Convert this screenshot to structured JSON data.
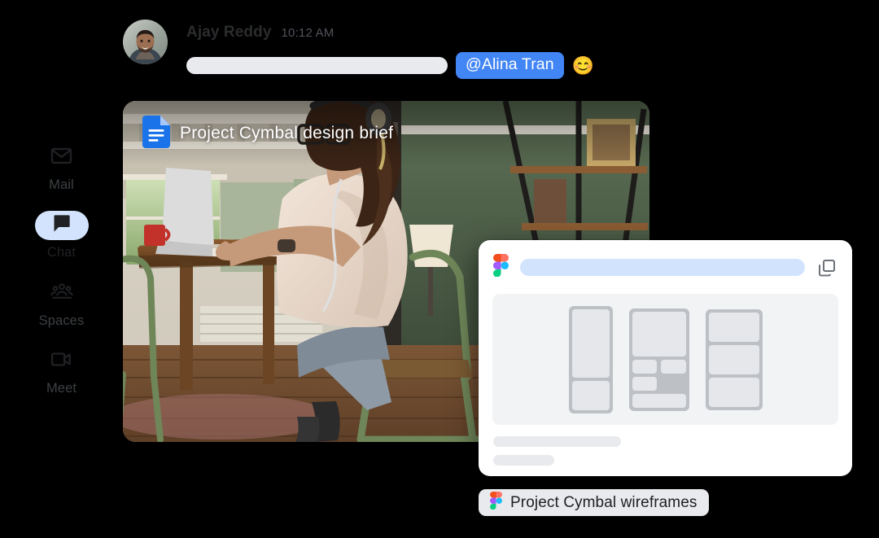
{
  "sidebar": {
    "items": [
      {
        "label": "Mail",
        "icon": "mail-icon",
        "active": false
      },
      {
        "label": "Chat",
        "icon": "chat-icon",
        "active": true
      },
      {
        "label": "Spaces",
        "icon": "spaces-icon",
        "active": false
      },
      {
        "label": "Meet",
        "icon": "meet-icon",
        "active": false
      }
    ]
  },
  "message": {
    "sender": "Ajay Reddy",
    "time": "10:12 AM",
    "avatar_alt": "avatar",
    "mention": "@Alina Tran",
    "emoji": "😊",
    "text_placeholder": ""
  },
  "doc_card": {
    "title": "Project Cymbal design brief",
    "icon": "google-docs-icon",
    "image_alt": "woman with headphones working on a laptop at a wooden table"
  },
  "figma_card": {
    "logo": "figma-icon",
    "url_placeholder": "",
    "copy_icon": "copy-icon",
    "meta_line_1": "",
    "meta_line_2": "",
    "wireframe": {
      "columns": [
        {
          "blocks": [
            {
              "h": 84
            },
            {
              "h": 36
            }
          ]
        },
        {
          "blocks": [
            {
              "h": 55
            },
            {
              "row": [
                {
                  "w": 45
                },
                {
                  "w": 50
                }
              ],
              "h": 18
            },
            {
              "w": 45,
              "h": 18
            },
            {
              "h": 18
            }
          ]
        },
        {
          "blocks": [
            {
              "h": 38
            },
            {
              "h": 38
            },
            {
              "h": 38
            }
          ]
        }
      ]
    }
  },
  "file_chip": {
    "label": "Project Cymbal wireframes",
    "icon": "figma-icon"
  },
  "colors": {
    "accent_blue": "#4285f4",
    "active_pill": "#d3e3fd",
    "url_pill": "#d2e3fd",
    "placeholder_gray": "#e8eaed",
    "wireframe_frame": "#bdc1c6",
    "wireframe_block": "#e5e7ea",
    "preview_bg": "#f1f3f4",
    "background": "#000000"
  }
}
